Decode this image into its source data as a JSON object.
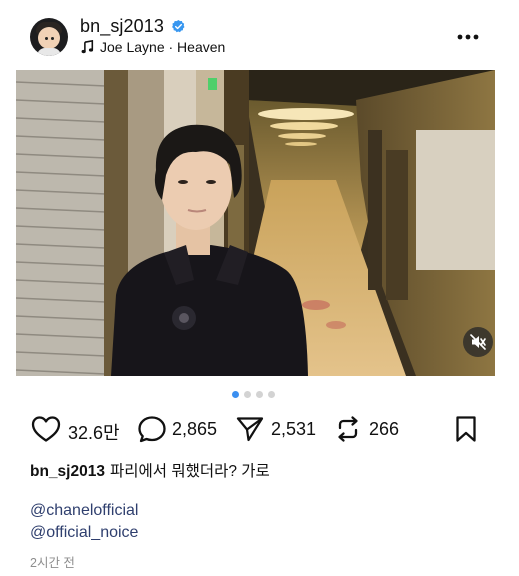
{
  "header": {
    "username": "bn_sj2013",
    "song": "Joe Layne · Heaven",
    "icons": [
      "avatar",
      "verified-badge-icon",
      "music-note-icon",
      "more-options-icon"
    ]
  },
  "post": {
    "media_icons": [
      "mute-icon"
    ],
    "carousel": {
      "count": 4,
      "active": 1
    }
  },
  "actions": {
    "likes": "32.6만",
    "comments": "2,865",
    "shares": "2,531",
    "reposts": "266",
    "icons": [
      "heart-icon",
      "comment-icon",
      "share-icon",
      "repost-icon",
      "bookmark-icon"
    ]
  },
  "caption": {
    "username": "bn_sj2013",
    "text": "파리에서 뭐했더라? 가로"
  },
  "mentions": [
    "@chanelofficial",
    "@official_noice"
  ],
  "timestamp": "2시간 전",
  "colors": {
    "verified_blue": "#3897f0",
    "dot_active": "#3b8ff0",
    "mention": "#2f3f6e",
    "muted_text": "#8e8e8e"
  }
}
